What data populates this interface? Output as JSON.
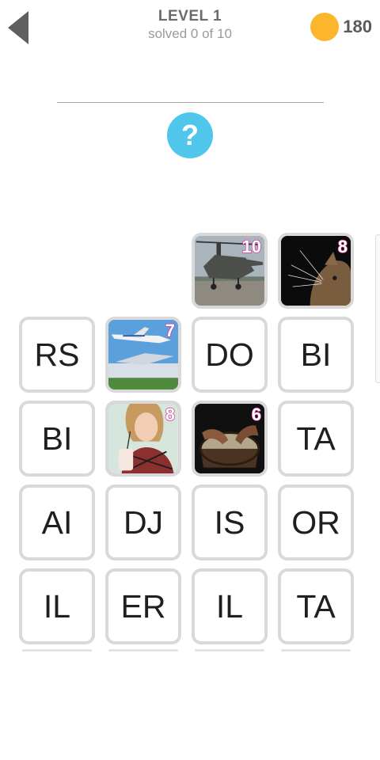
{
  "header": {
    "title": "LEVEL 1",
    "subtitle": "solved 0 of 10",
    "coins": "180"
  },
  "hint": {
    "label": "?"
  },
  "pictures": [
    {
      "subject": "helicopter",
      "count": "10"
    },
    {
      "subject": "cat",
      "count": "8"
    },
    {
      "subject": "airplane",
      "count": "7"
    },
    {
      "subject": "woman-with-drink",
      "count": "8"
    },
    {
      "subject": "drum",
      "count": "6"
    }
  ],
  "tiles": {
    "r2c1": "RS",
    "r2c3": "DO",
    "r2c4": "BI",
    "r3c1": "BI",
    "r3c4": "TA",
    "r4c1": "AI",
    "r4c2": "DJ",
    "r4c3": "IS",
    "r4c4": "OR",
    "r5c1": "IL",
    "r5c2": "ER",
    "r5c3": "IL",
    "r5c4": "TA"
  },
  "colors": {
    "coin": "#fcb62e",
    "hint": "#4fc6ea",
    "number_outline": "#d9319b",
    "tile_border": "#d9d9d9"
  }
}
